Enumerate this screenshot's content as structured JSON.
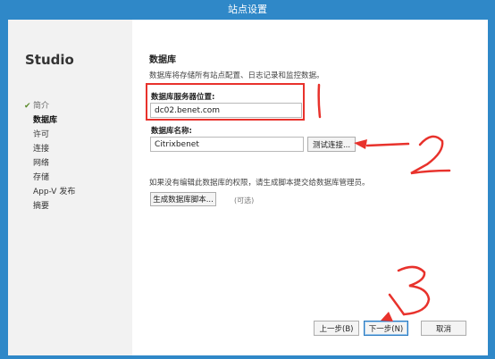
{
  "window": {
    "title": "站点设置"
  },
  "sidebar": {
    "app_title": "Studio",
    "items": [
      {
        "label": "简介",
        "state": "done"
      },
      {
        "label": "数据库",
        "state": "active"
      },
      {
        "label": "许可",
        "state": "pending"
      },
      {
        "label": "连接",
        "state": "pending"
      },
      {
        "label": "网络",
        "state": "pending"
      },
      {
        "label": "存储",
        "state": "pending"
      },
      {
        "label": "App-V 发布",
        "state": "pending"
      },
      {
        "label": "摘要",
        "state": "pending"
      }
    ]
  },
  "main": {
    "title": "数据库",
    "description": "数据库将存储所有站点配置、日志记录和监控数据。",
    "server_label": "数据库服务器位置:",
    "server_value": "dc02.benet.com",
    "dbname_label": "数据库名称:",
    "dbname_value": "Citrixbenet",
    "test_button": "测试连接...",
    "note": "如果没有编辑此数据库的权限，请生成脚本提交给数据库管理员。",
    "script_button": "生成数据库脚本...",
    "optional": "(可选)"
  },
  "footer": {
    "back_button": "上一步(B)",
    "next_button": "下一步(N)",
    "cancel_button": "取消"
  },
  "annotations": {
    "color": "#e8322c",
    "numbers": [
      "1",
      "2",
      "3"
    ]
  },
  "colors": {
    "frame": "#2f88c8",
    "sidebar": "#f2f2f2"
  }
}
